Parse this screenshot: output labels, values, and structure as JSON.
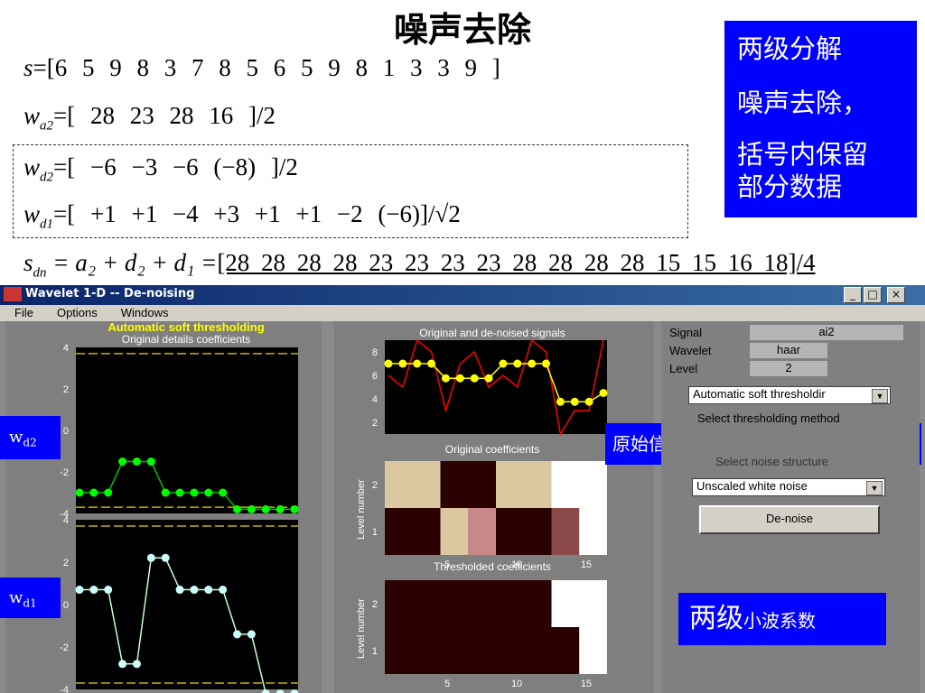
{
  "slide_title": "噪声去除",
  "equations": {
    "s": {
      "lhs_sym": "s",
      "text": "=[6  5  9  8  3  7  8  5  6  5  9  8  1  3  3  9  ]"
    },
    "wa2": {
      "lhs_sym": "w",
      "sub": "a2",
      "text": "=[   28   23   28   16   ]/2"
    },
    "wd2": {
      "lhs_sym": "w",
      "sub": "d2",
      "text": "=[   −6   −3   −6   (−8)   ]/2"
    },
    "wd1": {
      "lhs_sym": "w",
      "sub": "d1",
      "text": "=[   +1   +1   −4   +3   +1   +1   −2   (−6)]/√2"
    },
    "sdn": {
      "lhs_sym": "s",
      "sub": "dn",
      "mid": " = a₂ + d₂ + d₁ =",
      "text": "[28 28 28 28 23 23 23 23 28 28 28 28 15 15 16 18]/4"
    }
  },
  "note_box": {
    "line1": "两级分解",
    "line2": "噪声去除，",
    "line3": "括号内保留",
    "line4": "部分数据"
  },
  "window": {
    "title": "Wavelet 1-D  --  De-noising",
    "buttons": [
      "_",
      "□",
      "×"
    ],
    "menu": [
      "File",
      "Options",
      "Windows"
    ]
  },
  "left_panel": {
    "header": "Automatic soft thresholding",
    "title": "Original details coefficients",
    "label_d2": "w",
    "label_d2_sub": "d2",
    "label_d1": "w",
    "label_d1_sub": "d1"
  },
  "middle_panel": {
    "signal_title": "Original and de-noised signals",
    "orig_coef_title": "Original coefficients",
    "thr_coef_title": "Thresholded coefficients",
    "ylabel": "Level number"
  },
  "callout_signal": "原始信号 (红),去噪后　(黄)",
  "callout_coef": {
    "big": "两级",
    "small": "小波系数"
  },
  "right_panel": {
    "signal_label": "Signal",
    "signal_value": "ai2",
    "wavelet_label": "Wavelet",
    "wavelet_value": "haar",
    "level_label": "Level",
    "level_value": "2",
    "method_value": "Automatic soft thresholdir",
    "method_caption": "Select thresholding method",
    "noise_caption": "Select noise structure",
    "noise_value": "Unscaled white noise",
    "denoise_button": "De-noise"
  },
  "colors": {
    "accent_blue": "#0000ff",
    "signal_red": "#ff0000",
    "denoised_yellow": "#ffff00",
    "d2_green": "#00ff00",
    "d1_cyan": "#ccffff",
    "threshold": "#c8b400"
  },
  "chart_data": [
    {
      "type": "line",
      "name": "detail-d2",
      "x": [
        1,
        2,
        3,
        4,
        5,
        6,
        7,
        8,
        9,
        10,
        11,
        12,
        13,
        14,
        15,
        16
      ],
      "values": [
        -3,
        -3,
        -3,
        -1.5,
        -1.5,
        -1.5,
        -3,
        -3,
        -3,
        -3.8,
        -3.8,
        -3.8,
        -3,
        -3,
        -3,
        -3
      ],
      "plotted_values": [
        -3,
        -3,
        -3,
        -1.5,
        -1.5,
        -1.5,
        -3,
        -3,
        -3,
        -3,
        -3,
        -3.8,
        -3.8,
        -3.8,
        -3.8,
        -3.8
      ],
      "thresholds": [
        3.7,
        -3.7
      ],
      "ylim": [
        -4,
        4
      ],
      "yticks": [
        4,
        2,
        0,
        -2,
        -4
      ]
    },
    {
      "type": "line",
      "name": "detail-d1",
      "x": [
        1,
        2,
        3,
        4,
        5,
        6,
        7,
        8,
        9,
        10,
        11,
        12,
        13,
        14,
        15,
        16
      ],
      "values": [
        0.7,
        0.7,
        0.7,
        -2.8,
        -2.8,
        2.2,
        2.2,
        0.7,
        0.7,
        0.7,
        0.7,
        -1.4,
        -1.4,
        -4.2,
        -4.2,
        -4.2
      ],
      "thresholds": [
        3.7,
        -3.7
      ],
      "ylim": [
        -4,
        4
      ],
      "yticks": [
        4,
        2,
        0,
        -2,
        -4
      ],
      "xticks": [
        5,
        10,
        15
      ]
    },
    {
      "type": "line",
      "name": "signals",
      "x": [
        1,
        2,
        3,
        4,
        5,
        6,
        7,
        8,
        9,
        10,
        11,
        12,
        13,
        14,
        15,
        16
      ],
      "series": [
        {
          "name": "original",
          "values": [
            6,
            5,
            9,
            8,
            3,
            7,
            8,
            5,
            6,
            5,
            9,
            8,
            1,
            3,
            3,
            9
          ]
        },
        {
          "name": "de-noised",
          "values": [
            7,
            7,
            7,
            7,
            5.75,
            5.75,
            5.75,
            5.75,
            7,
            7,
            7,
            7,
            3.75,
            3.75,
            3.75,
            4.5
          ]
        }
      ],
      "ylim": [
        1,
        9
      ],
      "yticks": [
        8,
        6,
        4,
        2
      ],
      "xticks": [
        5,
        10,
        15
      ]
    },
    {
      "type": "heatmap",
      "name": "original-coefficients",
      "rows": [
        "2",
        "1"
      ],
      "levels": {
        "2": [
          2,
          0,
          2,
          3
        ],
        "1": [
          0,
          2,
          1,
          0,
          0,
          1
        ]
      },
      "xticks": [
        5,
        10,
        15
      ]
    },
    {
      "type": "heatmap",
      "name": "thresholded-coefficients",
      "rows": [
        "2",
        "1"
      ],
      "xticks": [
        5,
        10,
        15
      ]
    }
  ]
}
